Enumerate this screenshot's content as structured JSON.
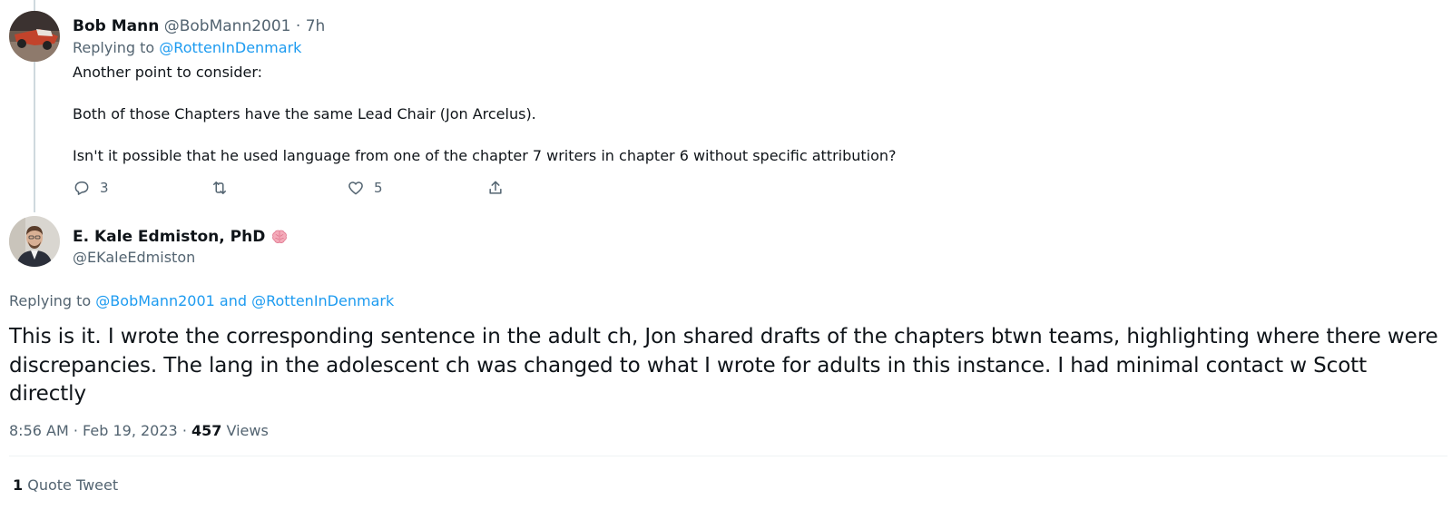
{
  "reply_tweet": {
    "author_name": "Bob Mann",
    "author_handle": "@BobMann2001",
    "time_ago": "7h",
    "separator": "·",
    "replying_prefix": "Replying to",
    "replying_to": "@RottenInDenmark",
    "body": [
      "Another point to consider:",
      "Both of those Chapters have the same Lead Chair (Jon Arcelus).",
      "Isn't it possible that he used language from one of the chapter 7 writers in chapter 6 without specific attribution?"
    ],
    "actions": {
      "reply_icon": "reply-icon",
      "reply_count": "3",
      "retweet_icon": "retweet-icon",
      "like_icon": "heart-icon",
      "like_count": "5",
      "share_icon": "share-icon"
    }
  },
  "main_tweet": {
    "author_name": "E. Kale Edmiston, PhD",
    "name_emoji": "brain-emoji",
    "author_handle": "@EKaleEdmiston",
    "replying_prefix": "Replying to",
    "replying_to": "@BobMann2001 and @RottenInDenmark",
    "body": "This is it. I wrote the corresponding sentence in the adult ch, Jon shared drafts of the chapters btwn teams, highlighting where there were discrepancies. The lang in the adolescent ch was changed to what I wrote for adults in this instance. I had minimal contact w Scott directly",
    "time": "8:56 AM",
    "date": "Feb 19, 2023",
    "views_count": "457",
    "views_label": "Views",
    "quote_count": "1",
    "quote_label": "Quote Tweet"
  },
  "colors": {
    "link": "#1d9bf0",
    "secondary_text": "#536471",
    "primary_text": "#0f1419",
    "thread_line": "#cfd9de"
  }
}
